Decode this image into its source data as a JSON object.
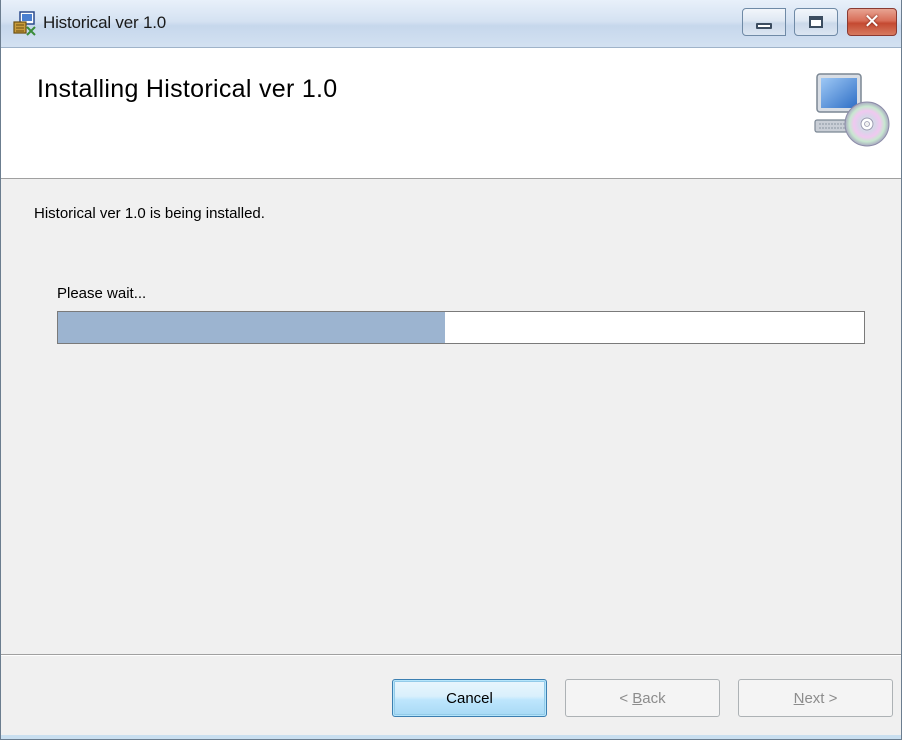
{
  "window": {
    "title": "Historical ver 1.0",
    "close_glyph": "✕",
    "icons": [
      "installer-icon",
      "minimize-icon",
      "maximize-icon",
      "close-icon"
    ]
  },
  "banner": {
    "title": "Installing Historical ver 1.0",
    "icon": "computer-cd-icon"
  },
  "body": {
    "status": "Historical ver 1.0 is being installed.",
    "wait_label": "Please wait...",
    "progress_percent": 48
  },
  "footer": {
    "cancel_label": "Cancel",
    "back_prefix": "< ",
    "back_mnemonic": "B",
    "back_rest": "ack",
    "next_mnemonic": "N",
    "next_rest": "ext",
    "next_suffix": " >"
  },
  "colors": {
    "progress_fill": "#9cb4d0",
    "banner_bg": "#ffffff",
    "body_bg": "#f0f0f0"
  }
}
